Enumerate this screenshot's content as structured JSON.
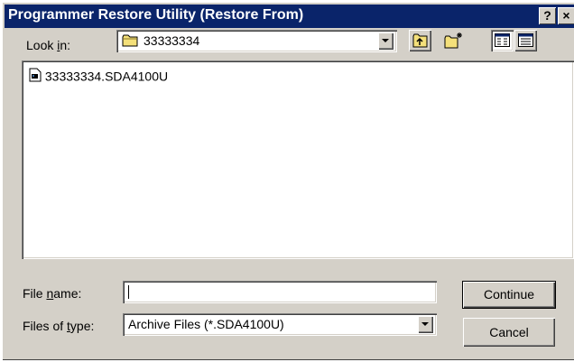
{
  "window": {
    "title": "Programmer Restore Utility (Restore From)",
    "help_button": "?",
    "close_button": "×"
  },
  "look_in": {
    "label_pre": "Look ",
    "label_accel": "i",
    "label_post": "n:",
    "value": "33333334",
    "icon": "folder-icon"
  },
  "toolbar": {
    "up_icon": "up-one-level-icon",
    "new_folder_icon": "new-folder-icon",
    "list_icon": "list-view-icon",
    "details_icon": "details-view-icon"
  },
  "file_list": {
    "items": [
      {
        "name": "33333334.SDA4100U",
        "icon": "file-icon"
      }
    ]
  },
  "file_name": {
    "label_pre": "File ",
    "label_accel": "n",
    "label_post": "ame:",
    "value": ""
  },
  "file_type": {
    "label_pre": "Files of ",
    "label_accel": "t",
    "label_post": "ype:",
    "value": "Archive Files (*.SDA4100U)"
  },
  "buttons": {
    "continue": "Continue",
    "cancel": "Cancel"
  },
  "colors": {
    "titlebar": "#0a246a",
    "face": "#d4d0c8",
    "folder": "#f4e07a"
  }
}
